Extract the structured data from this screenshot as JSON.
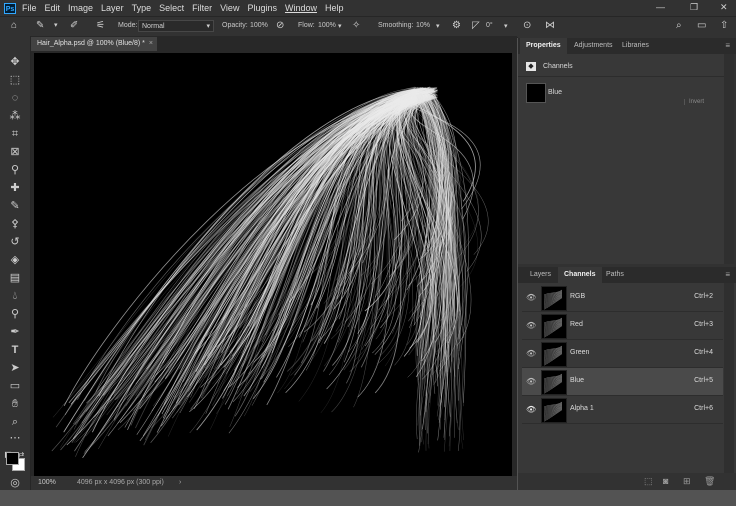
{
  "menu": {
    "logo": "Ps",
    "items": [
      "File",
      "Edit",
      "Image",
      "Layer",
      "Type",
      "Select",
      "Filter",
      "View",
      "Plugins",
      "Window",
      "Help"
    ]
  },
  "options": {
    "mode_label": "Mode:",
    "mode_value": "Normal",
    "opacity_label": "Opacity:",
    "opacity_value": "100%",
    "flow_label": "Flow:",
    "flow_value": "100%",
    "smoothing_label": "Smoothing:",
    "smoothing_value": "10%",
    "angle_value": "0°"
  },
  "document": {
    "tab_title": "Hair_Alpha.psd @ 100% (Blue/8) *",
    "zoom": "100%",
    "doc_info": "4096 px x 4096 px (300 ppi)"
  },
  "properties": {
    "tabs": [
      "Properties",
      "Adjustments",
      "Libraries"
    ],
    "section_label": "Channels",
    "channel_name": "Blue",
    "invert_label": "Invert"
  },
  "channels": {
    "tabs": [
      "Layers",
      "Channels",
      "Paths"
    ],
    "rows": [
      {
        "name": "RGB",
        "shortcut": "Ctrl+2"
      },
      {
        "name": "Red",
        "shortcut": "Ctrl+3"
      },
      {
        "name": "Green",
        "shortcut": "Ctrl+4"
      },
      {
        "name": "Blue",
        "shortcut": "Ctrl+5"
      },
      {
        "name": "Alpha 1",
        "shortcut": "Ctrl+6"
      }
    ]
  },
  "colors": {
    "accent": "#31a8ff",
    "panel_bg": "#323232",
    "canvas_bg": "#000000"
  }
}
